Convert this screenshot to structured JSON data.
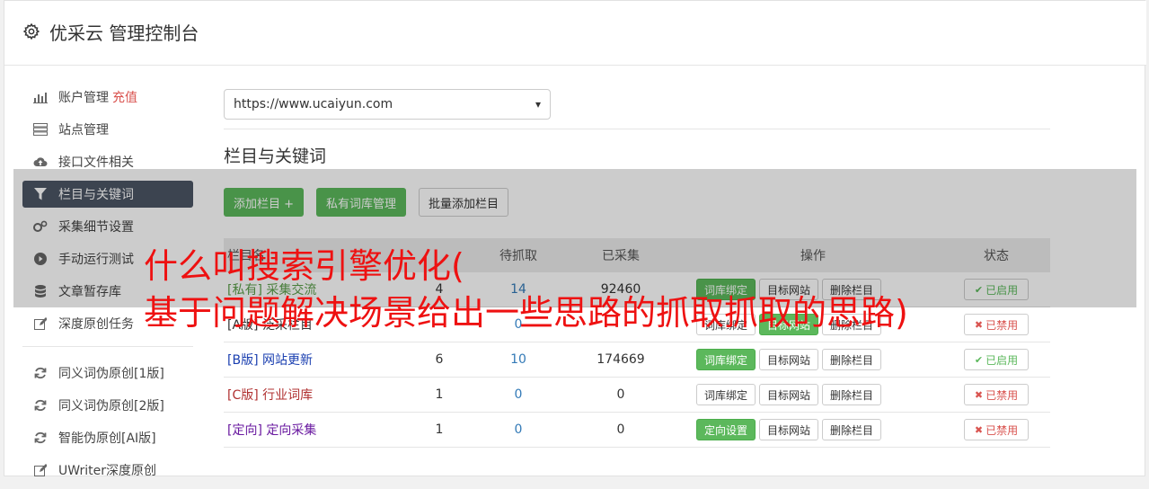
{
  "header": {
    "title": "优采云 管理控制台"
  },
  "sidebar": {
    "items": [
      {
        "label": "账户管理",
        "accent": "充值",
        "icon": "bar-chart-icon"
      },
      {
        "label": "站点管理",
        "icon": "server-icon"
      },
      {
        "label": "接口文件相关",
        "icon": "cloud-upload-icon"
      },
      {
        "label": "栏目与关键词",
        "icon": "filter-icon",
        "active": true
      },
      {
        "label": "采集细节设置",
        "icon": "gears-icon"
      },
      {
        "label": "手动运行测试",
        "icon": "play-circle-icon"
      },
      {
        "label": "文章暂存库",
        "icon": "database-icon"
      },
      {
        "label": "深度原创任务",
        "icon": "edit-icon"
      }
    ],
    "items2": [
      {
        "label": "同义词伪原创[1版]",
        "icon": "refresh-icon"
      },
      {
        "label": "同义词伪原创[2版]",
        "icon": "refresh-icon"
      },
      {
        "label": "智能伪原创[AI版]",
        "icon": "refresh-icon"
      },
      {
        "label": "UWriter深度原创",
        "icon": "edit-icon"
      }
    ]
  },
  "main": {
    "site_select": "https://www.ucaiyun.com",
    "section_title": "栏目与关键词",
    "buttons": {
      "add_column": "添加栏目 +",
      "private_lib": "私有词库管理",
      "batch_add": "批量添加栏目"
    },
    "table": {
      "headers": {
        "name": "栏目名",
        "c2": "",
        "pending": "待抓取",
        "collected": "已采集",
        "ops": "操作",
        "status": "状态"
      },
      "rows": [
        {
          "tag": "[私有]",
          "name": "采集交流",
          "color": "#5a9e4a",
          "n1": "4",
          "n2": "14",
          "n3": "92460",
          "op1": "词库绑定",
          "op1_green": true,
          "op2": "目标网站",
          "op3": "删除栏目",
          "status": "已启用",
          "on": true
        },
        {
          "tag": "[A版]",
          "name": "泛采栏目",
          "color": "#333333",
          "n1": "",
          "n2": "0",
          "n3": "",
          "op1": "词库绑定",
          "op1_green": false,
          "op2": "目标网站",
          "op3": "删除栏目",
          "status": "已禁用",
          "on": false
        },
        {
          "tag": "[B版]",
          "name": "网站更新",
          "color": "#1a3fb0",
          "n1": "6",
          "n2": "10",
          "n3": "174669",
          "op1": "词库绑定",
          "op1_green": true,
          "op2": "目标网站",
          "op3": "删除栏目",
          "status": "已启用",
          "on": true
        },
        {
          "tag": "[C版]",
          "name": "行业词库",
          "color": "#b03030",
          "n1": "1",
          "n2": "0",
          "n3": "0",
          "op1": "词库绑定",
          "op1_green": false,
          "op2": "目标网站",
          "op3": "删除栏目",
          "status": "已禁用",
          "on": false
        },
        {
          "tag": "[定向]",
          "name": "定向采集",
          "color": "#6a1aa0",
          "n1": "1",
          "n2": "0",
          "n3": "0",
          "op1": "定向设置",
          "op1_green": true,
          "op2": "目标网站",
          "op3": "删除栏目",
          "status": "已禁用",
          "on": false
        }
      ]
    }
  },
  "overlay": {
    "line1": "什么叫搜索引擎优化(",
    "line2": "基于问题解决场景给出一些思路的抓取抓取的思路)"
  },
  "colors": {
    "green": "#5cb85c",
    "red": "#d9534f",
    "active_bg": "#4b5565",
    "overlay_text": "#ee1111"
  }
}
